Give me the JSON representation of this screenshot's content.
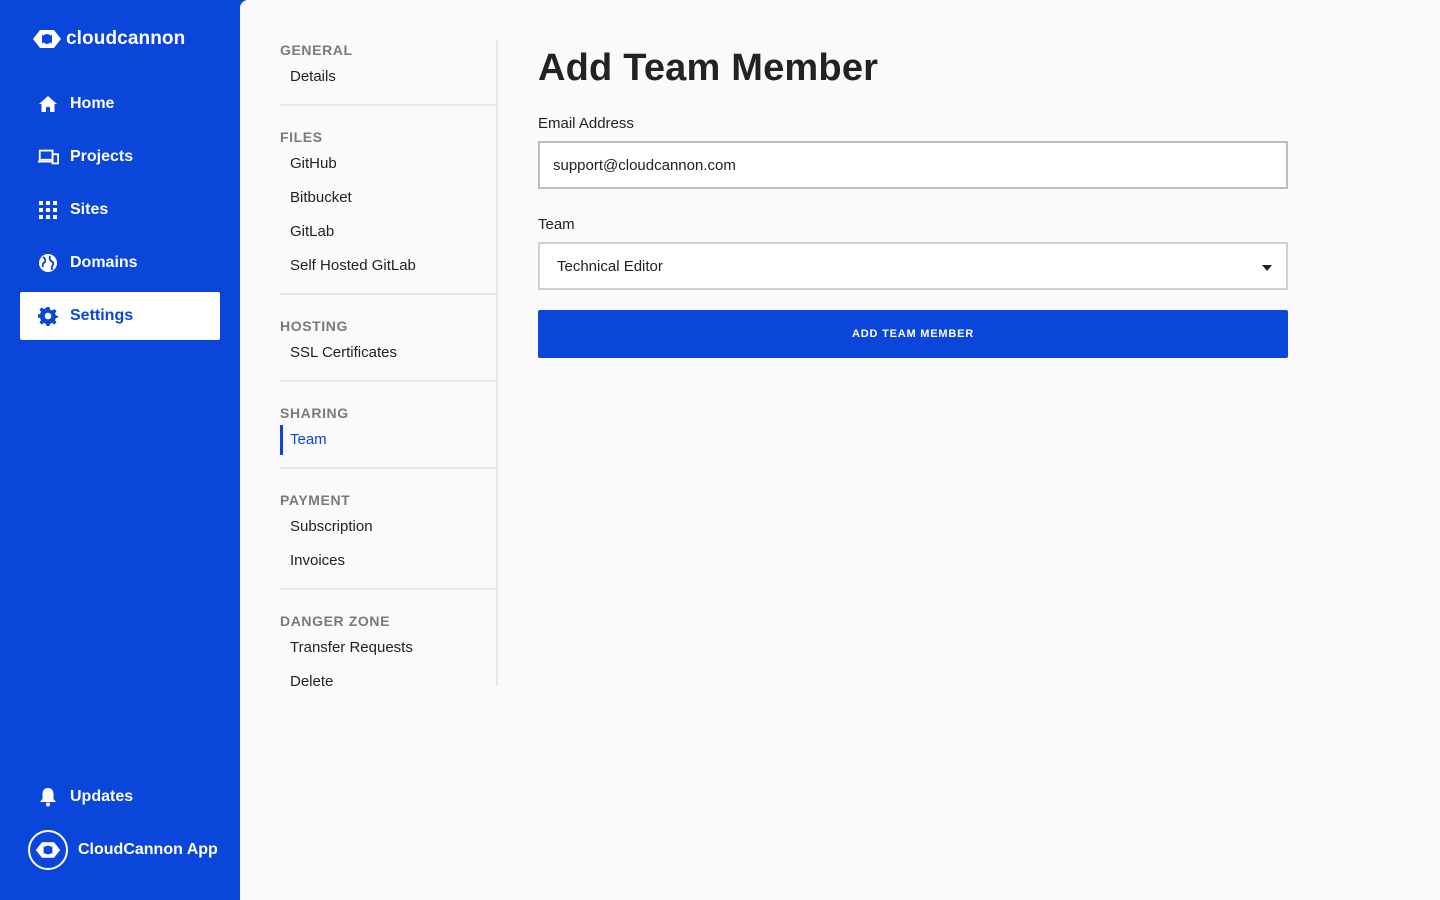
{
  "brand": {
    "name": "cloudcannon",
    "accent": "#0a46d9"
  },
  "nav": {
    "items": [
      {
        "label": "Home",
        "icon": "home-icon"
      },
      {
        "label": "Projects",
        "icon": "devices-icon"
      },
      {
        "label": "Sites",
        "icon": "grid-icon"
      },
      {
        "label": "Domains",
        "icon": "globe-icon"
      },
      {
        "label": "Settings",
        "icon": "gear-icon",
        "active": true
      }
    ],
    "updates": {
      "label": "Updates",
      "icon": "bell-icon"
    },
    "account": {
      "label": "CloudCannon App",
      "icon": "cloudcannon-logo-icon"
    }
  },
  "subnav": {
    "sections": [
      {
        "heading": "GENERAL",
        "links": [
          "Details"
        ]
      },
      {
        "heading": "FILES",
        "links": [
          "GitHub",
          "Bitbucket",
          "GitLab",
          "Self Hosted GitLab"
        ]
      },
      {
        "heading": "HOSTING",
        "links": [
          "SSL Certificates"
        ]
      },
      {
        "heading": "SHARING",
        "links": [
          "Team"
        ],
        "active_link": "Team"
      },
      {
        "heading": "PAYMENT",
        "links": [
          "Subscription",
          "Invoices"
        ]
      },
      {
        "heading": "DANGER ZONE",
        "links": [
          "Transfer Requests",
          "Delete"
        ]
      }
    ]
  },
  "form": {
    "title": "Add Team Member",
    "email_label": "Email Address",
    "email_value": "support@cloudcannon.com",
    "team_label": "Team",
    "team_value": "Technical Editor",
    "submit_label": "ADD TEAM MEMBER"
  }
}
